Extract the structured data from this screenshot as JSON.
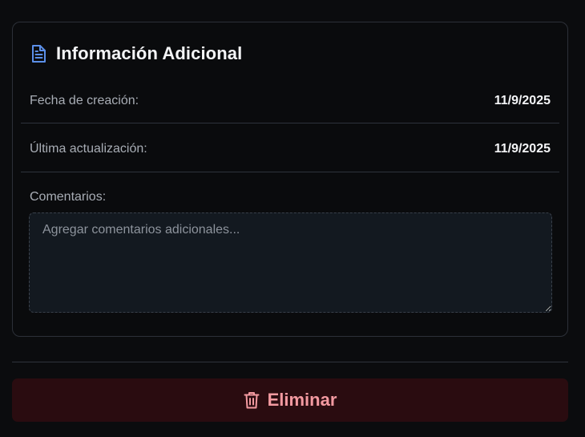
{
  "card": {
    "title": "Información Adicional",
    "icon": "document-icon",
    "accent_color": "#5b8fe8",
    "rows": [
      {
        "label": "Fecha de creación:",
        "value": "11/9/2025"
      },
      {
        "label": "Última actualización:",
        "value": "11/9/2025"
      }
    ],
    "comments": {
      "label": "Comentarios:",
      "placeholder": "Agregar comentarios adicionales...",
      "value": ""
    }
  },
  "actions": {
    "delete_label": "Eliminar",
    "delete_icon": "trash-icon",
    "delete_color": "#f39aa1"
  }
}
